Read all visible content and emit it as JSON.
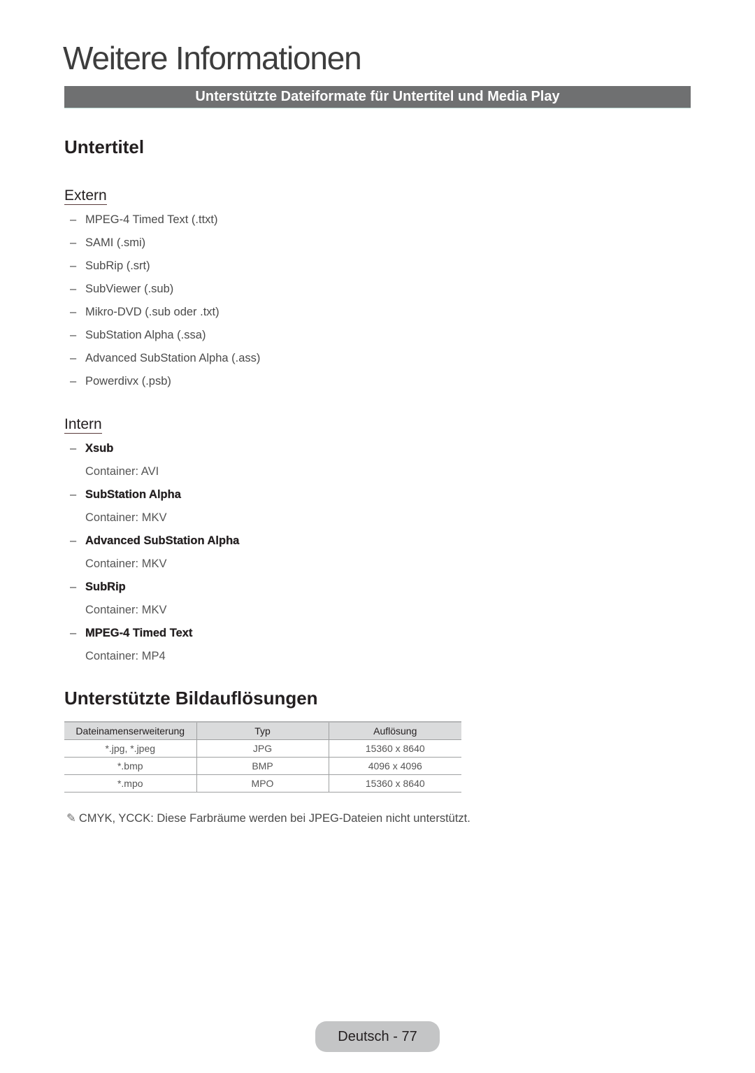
{
  "header": {
    "title": "Weitere Informationen",
    "banner": "Unterstützte Dateiformate für Untertitel und Media Play"
  },
  "subtitles": {
    "heading": "Untertitel",
    "external": {
      "heading": "Extern",
      "items": [
        "MPEG-4 Timed Text (.ttxt)",
        "SAMI (.smi)",
        "SubRip (.srt)",
        "SubViewer (.sub)",
        "Mikro-DVD (.sub oder .txt)",
        "SubStation Alpha (.ssa)",
        "Advanced SubStation Alpha (.ass)",
        "Powerdivx (.psb)"
      ]
    },
    "internal": {
      "heading": "Intern",
      "items": [
        {
          "name": "Xsub",
          "container": "Container: AVI"
        },
        {
          "name": "SubStation Alpha",
          "container": "Container: MKV"
        },
        {
          "name": "Advanced SubStation Alpha",
          "container": "Container: MKV"
        },
        {
          "name": "SubRip",
          "container": "Container: MKV"
        },
        {
          "name": "MPEG-4 Timed Text",
          "container": "Container: MP4"
        }
      ]
    }
  },
  "resolutions": {
    "heading": "Unterstützte Bildauflösungen",
    "columns": [
      "Dateinamenserweiterung",
      "Typ",
      "Auflösung"
    ],
    "rows": [
      [
        "*.jpg, *.jpeg",
        "JPG",
        "15360 x 8640"
      ],
      [
        "*.bmp",
        "BMP",
        "4096 x 4096"
      ],
      [
        "*.mpo",
        "MPO",
        "15360 x 8640"
      ]
    ],
    "note_icon": "pencil-note-icon",
    "note": "CMYK, YCCK: Diese Farbräume werden bei JPEG-Dateien nicht unterstützt."
  },
  "footer": {
    "page_label": "Deutsch - 77"
  },
  "colors": {
    "banner_bg": "#6f7071",
    "table_header_bg": "#dadbdc",
    "page_badge_bg": "#c4c5c6"
  }
}
